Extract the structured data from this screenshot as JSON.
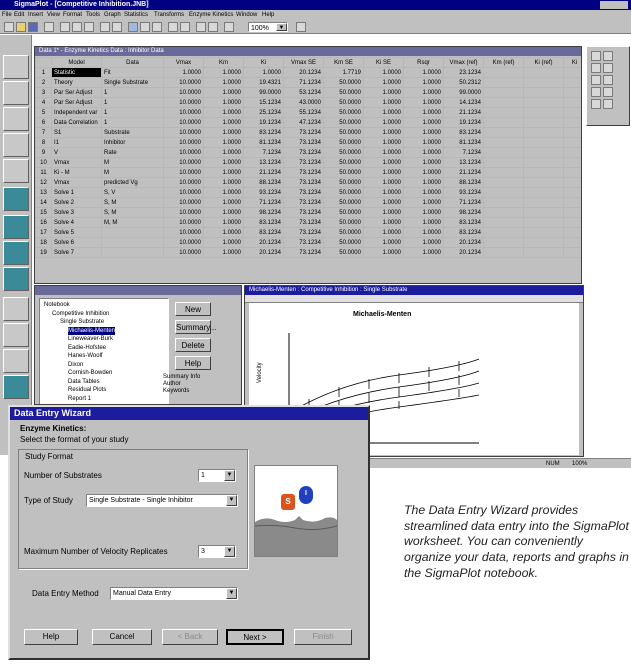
{
  "app": {
    "title": "SigmaPlot - [Competitive Inhibition.JNB]",
    "menu": [
      "File",
      "Edit",
      "Insert",
      "View",
      "Format",
      "Tools",
      "Graph",
      "Statistics",
      "Transforms",
      "Enzyme Kinetics",
      "Window",
      "Help"
    ],
    "zoom": "100%"
  },
  "worksheet": {
    "title": "Data 1* - Enzyme Kinetics Data : Inhibitor Data",
    "columns": [
      "",
      "Model",
      "Data",
      "Vmax",
      "Km",
      "Ki",
      "Vmax SE",
      "Km SE",
      "Ki SE",
      "Rsqr",
      "Vmax (ref)",
      "Km (ref)",
      "Ki (ref)",
      "Ki"
    ],
    "rows": [
      [
        "1",
        "Statistic",
        "Fit",
        "1.0000",
        "1.0000",
        "1.0000",
        "20.1234",
        "1.7719",
        "1.0000",
        "1.0000",
        "23.1234"
      ],
      [
        "2",
        "Theory",
        "Single Substrate",
        "10.0000",
        "1.0000",
        "19.4321",
        "71.1234",
        "50.0000",
        "1.0000",
        "1.0000",
        "50.2312"
      ],
      [
        "3",
        "Par Ser Adjust",
        "1",
        "10.0000",
        "1.0000",
        "99.0000",
        "53.1234",
        "50.0000",
        "1.0000",
        "1.0000",
        "99.0000"
      ],
      [
        "4",
        "Par Ser Adjust",
        "1",
        "10.0000",
        "1.0000",
        "15.1234",
        "43.0000",
        "50.0000",
        "1.0000",
        "1.0000",
        "14.1234"
      ],
      [
        "5",
        "Independent var",
        "1",
        "10.0000",
        "1.0000",
        "25.1234",
        "55.1234",
        "50.0000",
        "1.0000",
        "1.0000",
        "21.1234"
      ],
      [
        "6",
        "Data Correlation",
        "1",
        "10.0000",
        "1.0000",
        "19.1234",
        "47.1234",
        "50.0000",
        "1.0000",
        "1.0000",
        "19.1234"
      ],
      [
        "7",
        "S1",
        "Substrate",
        "10.0000",
        "1.0000",
        "83.1234",
        "73.1234",
        "50.0000",
        "1.0000",
        "1.0000",
        "83.1234"
      ],
      [
        "8",
        "I1",
        "Inhibitor",
        "10.0000",
        "1.0000",
        "81.1234",
        "73.1234",
        "50.0000",
        "1.0000",
        "1.0000",
        "81.1234"
      ],
      [
        "9",
        "V",
        "Rate",
        "10.0000",
        "1.0000",
        "7.1234",
        "73.1234",
        "50.0000",
        "1.0000",
        "1.0000",
        "7.1234"
      ],
      [
        "10",
        "Vmax",
        "M",
        "10.0000",
        "1.0000",
        "13.1234",
        "73.1234",
        "50.0000",
        "1.0000",
        "1.0000",
        "13.1234"
      ],
      [
        "11",
        "Ki - M",
        "M",
        "10.0000",
        "1.0000",
        "21.1234",
        "73.1234",
        "50.0000",
        "1.0000",
        "1.0000",
        "21.1234"
      ],
      [
        "12",
        "Vmax",
        "predicted Vg",
        "10.0000",
        "1.0000",
        "88.1234",
        "73.1234",
        "50.0000",
        "1.0000",
        "1.0000",
        "88.1234"
      ],
      [
        "13",
        "Solve 1",
        "S, V",
        "10.0000",
        "1.0000",
        "93.1234",
        "73.1234",
        "50.0000",
        "1.0000",
        "1.0000",
        "93.1234"
      ],
      [
        "14",
        "Solve 2",
        "S, M",
        "10.0000",
        "1.0000",
        "71.1234",
        "73.1234",
        "50.0000",
        "1.0000",
        "1.0000",
        "71.1234"
      ],
      [
        "15",
        "Solve 3",
        "S, M",
        "10.0000",
        "1.0000",
        "98.1234",
        "73.1234",
        "50.0000",
        "1.0000",
        "1.0000",
        "98.1234"
      ],
      [
        "16",
        "Solve 4",
        "M, M",
        "10.0000",
        "1.0000",
        "83.1234",
        "73.1234",
        "50.0000",
        "1.0000",
        "1.0000",
        "83.1234"
      ],
      [
        "17",
        "Solve 5",
        "",
        "10.0000",
        "1.0000",
        "83.1234",
        "73.1234",
        "50.0000",
        "1.0000",
        "1.0000",
        "83.1234"
      ],
      [
        "18",
        "Solve 6",
        "",
        "10.0000",
        "1.0000",
        "20.1234",
        "73.1234",
        "50.0000",
        "1.0000",
        "1.0000",
        "20.1234"
      ],
      [
        "19",
        "Solve 7",
        "",
        "10.0000",
        "1.0000",
        "20.1234",
        "73.1234",
        "50.0000",
        "1.0000",
        "1.0000",
        "20.1234"
      ]
    ]
  },
  "notebook": {
    "tree": [
      "Notebook",
      "Competitive Inhibition",
      "Single Substrate",
      "Michaelis-Menten",
      "Lineweaver-Burk",
      "Eadie-Hofstee",
      "Hanes-Woolf",
      "Dixon",
      "Cornish-Bowden",
      "Data Tables",
      "Residual Plots",
      "Report 1"
    ],
    "buttons": [
      "New",
      "Summary...",
      "Delete",
      "Help"
    ],
    "info": [
      "Summary Info",
      "Author",
      "Keywords"
    ]
  },
  "graph": {
    "window_title": "Michaelis-Menten : Competitive Inhibition : Single Substrate",
    "chart_title": "Michaelis-Menten",
    "ylabel": "Velocity"
  },
  "wizard": {
    "title": "Data Entry Wizard",
    "heading": "Enzyme Kinetics:",
    "subheading": "Select the format of your study",
    "group_label": "Study Format",
    "substrates_label": "Number of Substrates",
    "substrates_value": "1",
    "study_type_label": "Type of Study",
    "study_type_value": "Single Substrate - Single Inhibitor",
    "replicates_label": "Maximum Number of Velocity Replicates",
    "replicates_value": "3",
    "method_label": "Data Entry Method",
    "method_value": "Manual Data Entry",
    "buttons": [
      "Help",
      "Cancel",
      "< Back",
      "Next >",
      "Finish"
    ],
    "badge_s": "S",
    "badge_i": "I"
  },
  "status": {
    "mode": "NUM",
    "position": "100%"
  },
  "caption": "The Data Entry Wizard provides streamlined data entry into the SigmaPlot worksheet. You can conveniently organize your data, reports and graphs in the SigmaPlot notebook.",
  "colors": {
    "titlebar": "#000080",
    "wizard_title": "#1c1c9c",
    "badge_s": "#d9541e",
    "badge_i": "#2040c0"
  }
}
